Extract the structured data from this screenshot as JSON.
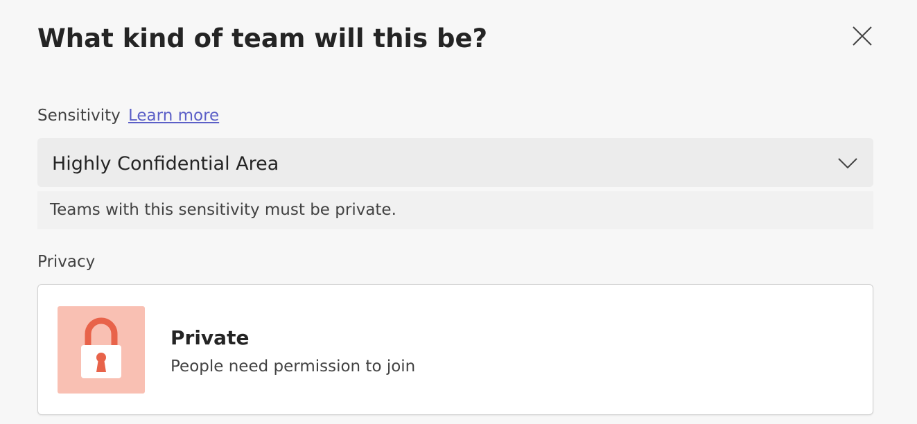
{
  "dialog": {
    "title": "What kind of team will this be?",
    "close_icon": "close-icon"
  },
  "sensitivity": {
    "label": "Sensitivity",
    "learn_more": "Learn more",
    "selected": "Highly Confidential Area",
    "chevron_icon": "chevron-down-icon",
    "info": "Teams with this sensitivity must be private."
  },
  "privacy": {
    "label": "Privacy",
    "option": {
      "icon": "lock-icon",
      "title": "Private",
      "description": "People need permission to join"
    }
  },
  "colors": {
    "accent_link": "#5b5fc7",
    "lock_tile_bg": "#f9c0b3",
    "lock_icon": "#e8634a"
  }
}
